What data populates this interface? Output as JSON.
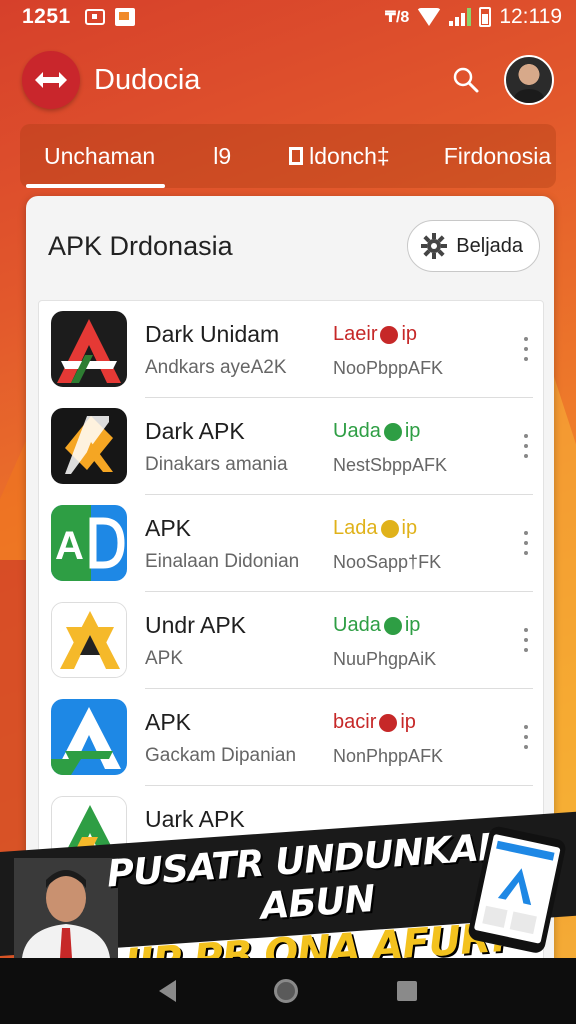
{
  "status_bar": {
    "time_left": "1251",
    "network_label": "₸/8",
    "time_right": "12:119"
  },
  "app_bar": {
    "title": "Dudocia",
    "icon": "arrow-left-right-icon"
  },
  "tabs": [
    {
      "label": "Unchaman",
      "active": true
    },
    {
      "label": "l9"
    },
    {
      "label": "ldonch‡"
    },
    {
      "label": "Firdonosia"
    }
  ],
  "card": {
    "title": "APK Drdonasia",
    "filter_label": "Beljada"
  },
  "apps": [
    {
      "name": "Dark Unidam",
      "desc": "Andkars ayeA2K",
      "status": "Laeir",
      "status_suffix": "ip",
      "status_color": "#c62828",
      "source": "NooPbppAFK",
      "icon": "dark-unidam-app-icon"
    },
    {
      "name": "Dark APK",
      "desc": "Dinakars amania",
      "status": "Uada",
      "status_suffix": "ip",
      "status_color": "#2e9e44",
      "source": "NestSbppAFK",
      "icon": "dark-apk-app-icon"
    },
    {
      "name": "APK",
      "desc": "Einalaan Didonian",
      "status": "Lada",
      "status_suffix": "ip",
      "status_color": "#e0b21a",
      "source": "NooSapp†FK",
      "icon": "ad-app-icon"
    },
    {
      "name": "Undr APK",
      "desc": "APK",
      "status": "Uada",
      "status_suffix": "ip",
      "status_color": "#2e9e44",
      "source": "NuuPhgpAiK",
      "icon": "undr-apk-app-icon"
    },
    {
      "name": "APK",
      "desc": "Gackam Dipanian",
      "status": "bacir",
      "status_suffix": "ip",
      "status_color": "#c62828",
      "source": "NonPhppAFK",
      "icon": "apk-blue-app-icon"
    },
    {
      "name": "Uark APK",
      "desc": "",
      "status": "",
      "status_suffix": "",
      "status_color": "#c62828",
      "source": "",
      "icon": "uark-apk-app-icon"
    }
  ],
  "banner": {
    "line1": "PUSATR UNDUNKAN-AБUN",
    "line2": "IIP PB ONA AFUR!"
  },
  "colors": {
    "logo_red": "#c9262c",
    "accent_green": "#2e9e44",
    "accent_red": "#c62828",
    "accent_yellow": "#e0b21a",
    "banner_yellow": "#f3c21e"
  }
}
